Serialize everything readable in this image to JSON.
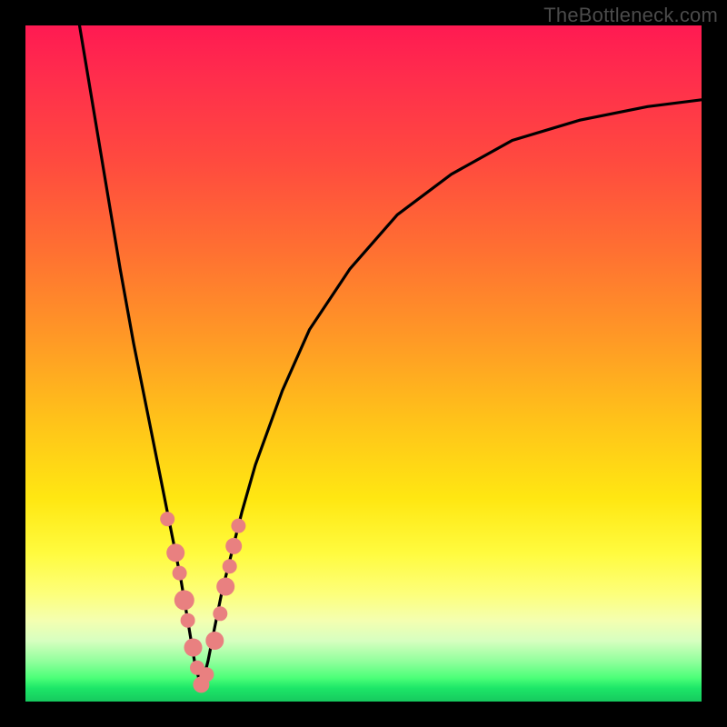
{
  "watermark": "TheBottleneck.com",
  "colors": {
    "frame": "#000000",
    "curve": "#000000",
    "dot": "#e98080",
    "gradient_top": "#ff1a52",
    "gradient_mid": "#ffe712",
    "gradient_bottom": "#16c95e"
  },
  "chart_data": {
    "type": "line",
    "title": "",
    "xlabel": "",
    "ylabel": "",
    "xlim": [
      0,
      100
    ],
    "ylim": [
      0,
      100
    ],
    "note": "V-shaped bottleneck curve. y≈100 means severe mismatch (red), y≈0 means balanced (green). Minimum at x≈26.",
    "series": [
      {
        "name": "left-branch",
        "x": [
          8,
          10,
          12,
          14,
          16,
          18,
          20,
          21,
          22,
          23,
          24,
          25,
          26
        ],
        "y": [
          100,
          88,
          76,
          64,
          53,
          43,
          33,
          28,
          23,
          18,
          12,
          6,
          2
        ]
      },
      {
        "name": "right-branch",
        "x": [
          26,
          27,
          28,
          29,
          30,
          32,
          34,
          38,
          42,
          48,
          55,
          63,
          72,
          82,
          92,
          100
        ],
        "y": [
          2,
          6,
          11,
          16,
          20,
          28,
          35,
          46,
          55,
          64,
          72,
          78,
          83,
          86,
          88,
          89
        ]
      }
    ],
    "highlight_points": {
      "name": "sample-dots",
      "x": [
        21.0,
        22.2,
        22.8,
        23.5,
        24.0,
        24.8,
        25.4,
        26.0,
        26.8,
        28.0,
        28.8,
        29.6,
        30.2,
        30.8,
        31.5
      ],
      "y": [
        27,
        22,
        19,
        15,
        12,
        8,
        5,
        2.5,
        4,
        9,
        13,
        17,
        20,
        23,
        26
      ],
      "r": [
        8,
        10,
        8,
        11,
        8,
        10,
        8,
        9,
        8,
        10,
        8,
        10,
        8,
        9,
        8
      ]
    }
  }
}
